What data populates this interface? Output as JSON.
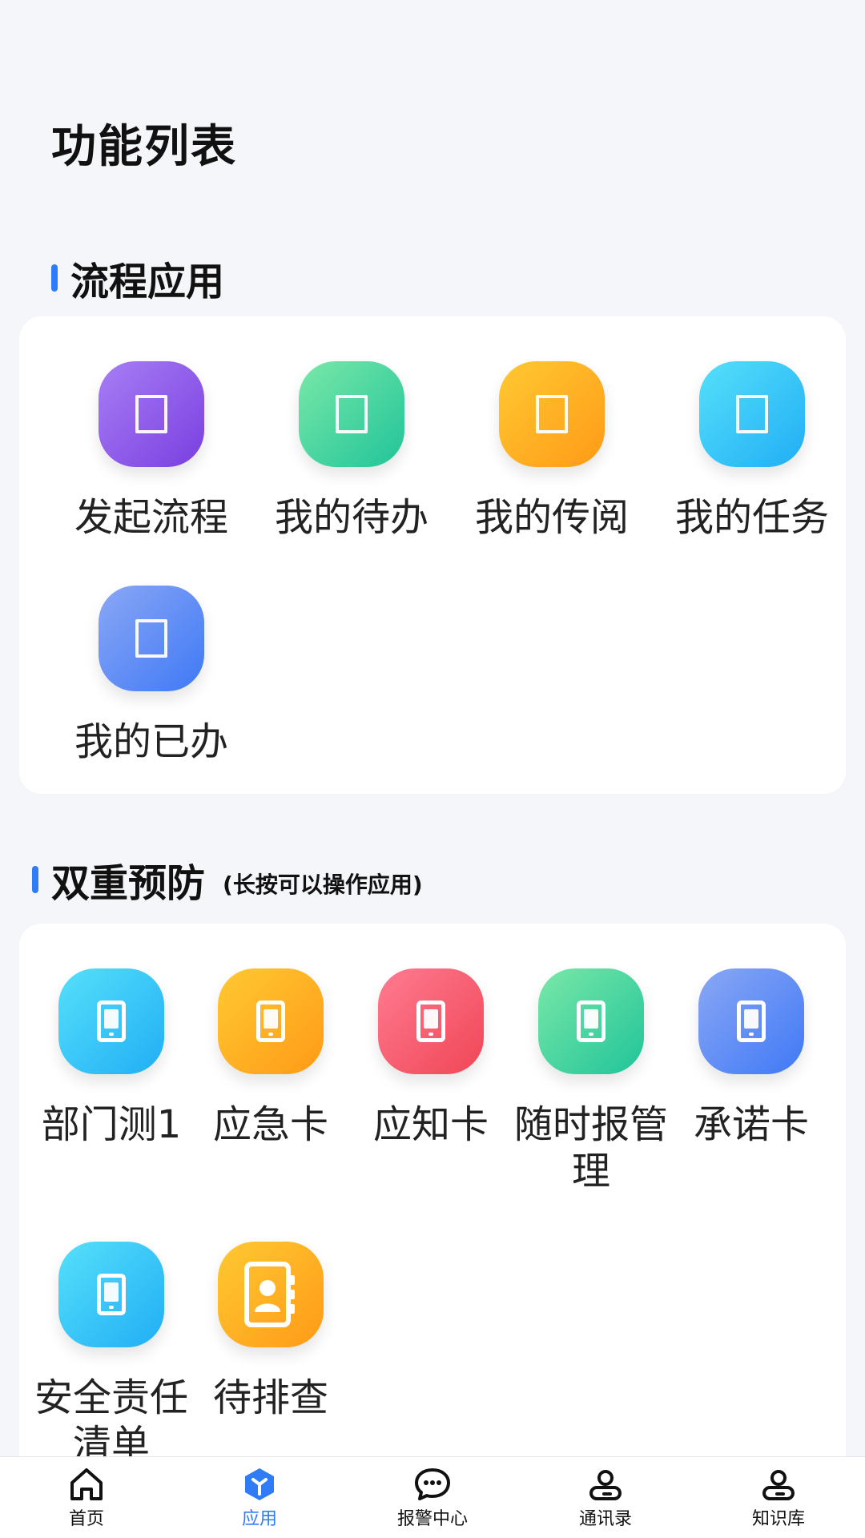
{
  "page": {
    "title": "功能列表"
  },
  "sections": [
    {
      "title": "流程应用",
      "subtitle": "",
      "items": [
        {
          "label": "发起流程"
        },
        {
          "label": "我的待办"
        },
        {
          "label": "我的传阅"
        },
        {
          "label": "我的任务"
        },
        {
          "label": "我的已办"
        }
      ]
    },
    {
      "title": "双重预防",
      "subtitle": "(长按可以操作应用)",
      "items": [
        {
          "label": "部门测1"
        },
        {
          "label": "应急卡"
        },
        {
          "label": "应知卡"
        },
        {
          "label": "随时报管理"
        },
        {
          "label": "承诺卡"
        },
        {
          "label": "安全责任清单"
        },
        {
          "label": "待排查"
        }
      ]
    }
  ],
  "tabbar": {
    "items": [
      {
        "label": "首页",
        "icon": "home-icon"
      },
      {
        "label": "应用",
        "icon": "apps-cube-icon",
        "active": true
      },
      {
        "label": "报警中心",
        "icon": "chat-bubble-icon"
      },
      {
        "label": "通讯录",
        "icon": "contacts-icon"
      },
      {
        "label": "知识库",
        "icon": "knowledge-icon"
      }
    ]
  },
  "colors": {
    "accent": "#2f7cf6",
    "background": "#f5f6fa",
    "card": "#ffffff"
  }
}
